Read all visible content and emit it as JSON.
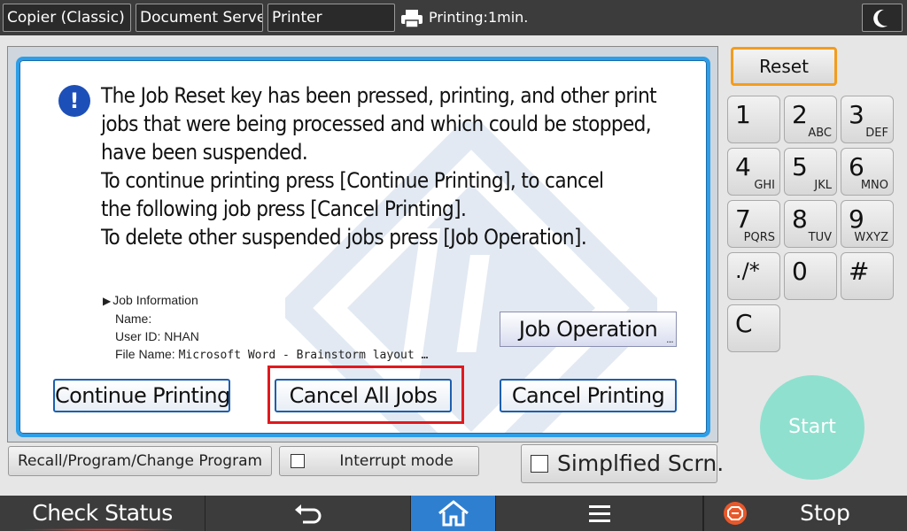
{
  "topbar": {
    "tabs": [
      "Copier (Classic)",
      "Document Server",
      "Printer"
    ],
    "status": "Printing:1min.",
    "printer_icon": "printer-icon",
    "moon_icon": "moon-icon"
  },
  "dialog": {
    "icon": "exclamation-icon",
    "message": [
      "The Job Reset key has been pressed, printing, and other print",
      "jobs that were being processed and which could be stopped,",
      "have been suspended.",
      "To continue printing press [Continue Printing], to cancel",
      "the following job press [Cancel Printing].",
      "To delete other suspended jobs press [Job Operation]."
    ],
    "job_info": {
      "header": "Job Information",
      "name": "Name:",
      "user_id": "User ID: NHAN",
      "file_name_label": "File Name:",
      "file_name": "Microsoft Word - Brainstorm layout …"
    },
    "job_operation": "Job Operation",
    "continue_printing": "Continue Printing",
    "cancel_all_jobs": "Cancel All Jobs",
    "cancel_printing": "Cancel Printing",
    "highlight_color": "#e0191e"
  },
  "lower": {
    "recall": "Recall/Program/Change Program",
    "interrupt": "Interrupt mode",
    "simplified": "Simplfied Scrn."
  },
  "keypad": {
    "reset": "Reset",
    "keys": [
      {
        "n": "1",
        "l": ""
      },
      {
        "n": "2",
        "l": "ABC"
      },
      {
        "n": "3",
        "l": "DEF"
      },
      {
        "n": "4",
        "l": "GHI"
      },
      {
        "n": "5",
        "l": "JKL"
      },
      {
        "n": "6",
        "l": "MNO"
      },
      {
        "n": "7",
        "l": "PQRS"
      },
      {
        "n": "8",
        "l": "TUV"
      },
      {
        "n": "9",
        "l": "WXYZ"
      },
      {
        "n": "./*",
        "l": ""
      },
      {
        "n": "0",
        "l": ""
      },
      {
        "n": "#",
        "l": ""
      },
      {
        "n": "C",
        "l": ""
      }
    ],
    "start": "Start"
  },
  "bottombar": {
    "check_status": "Check Status",
    "stop": "Stop",
    "home_color": "#2f7fd1"
  }
}
